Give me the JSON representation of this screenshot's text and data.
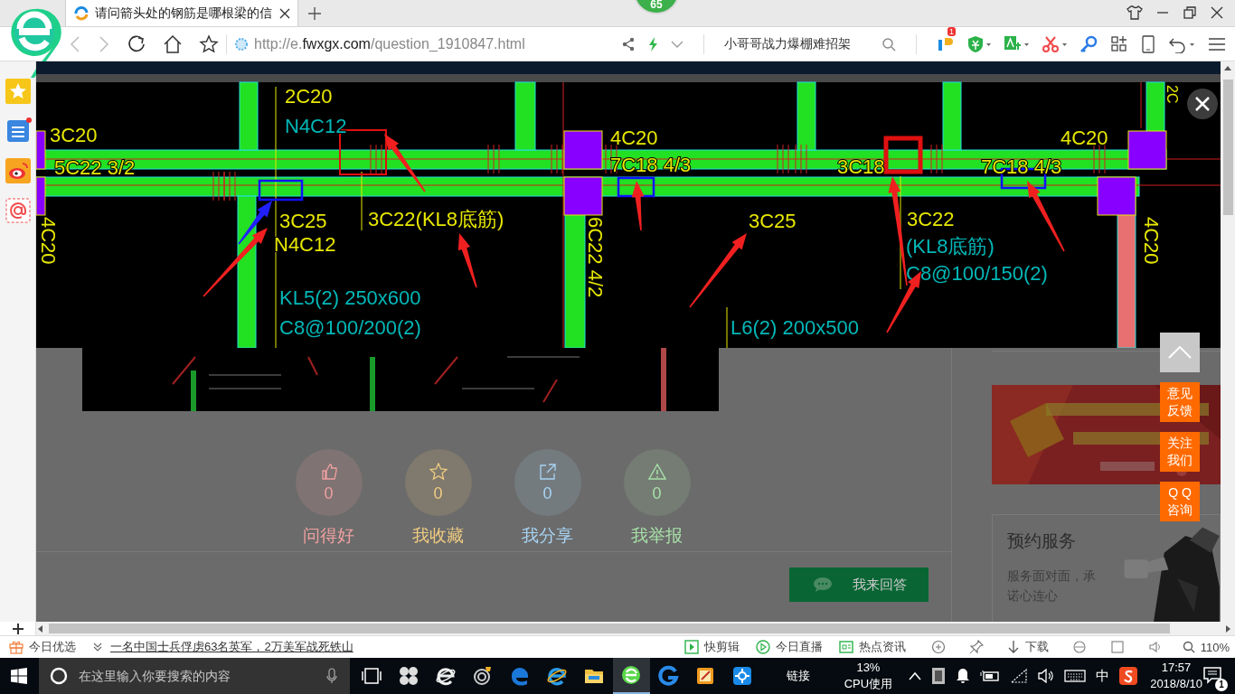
{
  "browser": {
    "logo_badge": "65",
    "tab_title": "请问箭头处的钢筋是哪根梁的信",
    "url": {
      "scheme": "http://e.",
      "domain": "fwxgx.com",
      "path": "/question_1910847.html"
    },
    "search_text": "小哥哥战力爆棚难招架",
    "plugin_badge": "1"
  },
  "sidebar": [
    {
      "kind": "favorites",
      "alert": false
    },
    {
      "kind": "list",
      "alert": true
    },
    {
      "kind": "weibo",
      "alert": false
    },
    {
      "kind": "mail",
      "alert": false
    }
  ],
  "viewer": {
    "labels": [
      {
        "text": "2C20",
        "color": "#e8e800"
      },
      {
        "text": "N4C12",
        "color": "#00b8b8"
      },
      {
        "text": "3C20",
        "color": "#e8e800"
      },
      {
        "text": "5C22 3/2",
        "color": "#e8e800"
      },
      {
        "text": "4C20",
        "color": "#e8e800"
      },
      {
        "text": "7C18 4/3",
        "color": "#e8e800"
      },
      {
        "text": "3C18",
        "color": "#e8e800"
      },
      {
        "text": "7C18 4/3",
        "color": "#e8e800"
      },
      {
        "text": "4C20",
        "color": "#e8e800"
      },
      {
        "text": "3C25",
        "color": "#e8e800"
      },
      {
        "text": "N4C12",
        "color": "#e8e800"
      },
      {
        "text": "3C22(KL8底筋)",
        "color": "#e8e800"
      },
      {
        "text": "6C22 4/2",
        "color": "#e8e800"
      },
      {
        "text": "3C25",
        "color": "#e8e800"
      },
      {
        "text": "3C22",
        "color": "#e8e800"
      },
      {
        "text": "(KL8底筋)",
        "color": "#00b8b8"
      },
      {
        "text": "C8@100/150(2)",
        "color": "#00b8b8"
      },
      {
        "text": "KL5(2) 250x600",
        "color": "#00b8b8"
      },
      {
        "text": "C8@100/200(2)",
        "color": "#00b8b8"
      },
      {
        "text": "L6(2) 200x500",
        "color": "#00b8b8"
      },
      {
        "text": "4C20",
        "color": "#e8e800"
      },
      {
        "text": "4C20",
        "color": "#e8e800"
      },
      {
        "text": "2C",
        "color": "#e8e800"
      }
    ]
  },
  "question": {
    "stats": [
      {
        "kind": "like",
        "count": "0",
        "label": "问得好",
        "color": "#f0a0a0"
      },
      {
        "kind": "favorite",
        "count": "0",
        "label": "我收藏",
        "color": "#f0cc80"
      },
      {
        "kind": "share",
        "count": "0",
        "label": "我分享",
        "color": "#a8d4f4"
      },
      {
        "kind": "report",
        "count": "0",
        "label": "我举报",
        "color": "#a8e0a8"
      }
    ],
    "answer_button": "我来回答"
  },
  "service": {
    "title": "预约服务",
    "text": "服务面对面，承诺心连心"
  },
  "float_buttons": [
    {
      "lines": [
        "意见",
        "反馈"
      ]
    },
    {
      "lines": [
        "关注",
        "我们"
      ]
    },
    {
      "lines": [
        "Q Q",
        "咨询"
      ]
    }
  ],
  "status_bar": {
    "today_label": "今日优选",
    "news": "一名中国士兵俘虏63名英军，2万美军战死铁山",
    "tools": [
      "快剪辑",
      "今日直播",
      "热点资讯"
    ],
    "download": "下载",
    "zoom": "110%"
  },
  "taskbar": {
    "search_placeholder": "在这里输入你要搜索的内容",
    "apps": [
      {
        "kind": "task-view",
        "selected": false
      },
      {
        "kind": "pinwheel",
        "selected": false
      },
      {
        "kind": "ie-white",
        "selected": false
      },
      {
        "kind": "swirl",
        "selected": false
      },
      {
        "kind": "edge",
        "selected": false
      },
      {
        "kind": "ie",
        "selected": false
      },
      {
        "kind": "folder",
        "selected": false
      },
      {
        "kind": "browser",
        "selected": true
      },
      {
        "kind": "g-app",
        "selected": false
      },
      {
        "kind": "notepad",
        "selected": false
      },
      {
        "kind": "plus-app",
        "selected": false
      }
    ],
    "link_label": "链接",
    "cpu_percent": "13%",
    "cpu_label": "CPU使用",
    "ime": "中",
    "time": "17:57",
    "date": "2018/8/10",
    "notification_count": "1"
  }
}
